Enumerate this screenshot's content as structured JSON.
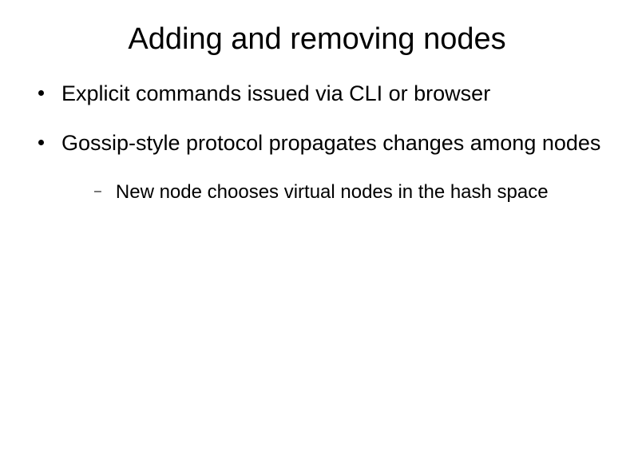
{
  "title": "Adding and removing nodes",
  "bullets": [
    {
      "text": "Explicit commands issued via CLI or browser",
      "subs": []
    },
    {
      "text": "Gossip-style protocol propagates changes among nodes",
      "subs": [
        {
          "text": "New node chooses virtual nodes in the hash space"
        }
      ]
    }
  ]
}
